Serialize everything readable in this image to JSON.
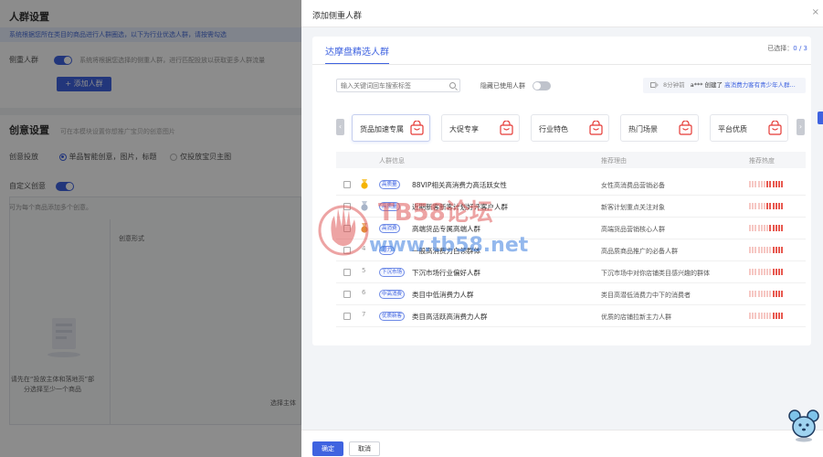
{
  "background": {
    "section1_title": "人群设置",
    "info_text": "系统根据您所在类目的商品进行人群圈选，以下为行业优选人群，请按需勾选",
    "row1_label": "侧重人群",
    "row1_desc": "系统将根据您选择的侧重人群，进行匹配投放以获取更多人群流量",
    "add_button": "+ 添加人群(0/3)",
    "section2_title": "创意设置",
    "section2_desc": "可在本模块设置你想推广宝贝的创意图片",
    "row2_label": "创意投放",
    "radio1": "单品智能创意，图片，标题",
    "radio2": "仅投放宝贝主图",
    "row3_label": "自定义创意",
    "panel_head": "可为每个商品添加多个创意。",
    "panel_col": "创意形式",
    "note": "请先在“投放主体和落地页”部分选择至少一个商品",
    "right_label": "选择主体"
  },
  "drawer": {
    "title": "添加侧重人群",
    "close": "×",
    "tab": "达摩盘精选人群",
    "selected_label": "已选择：",
    "selected_value": "0 / 3",
    "search_placeholder": "输入关键词回车搜索标签",
    "hide_used": "隐藏已使用人群",
    "notice_time": "8分钟前",
    "notice_user": "a*** 创建了",
    "notice_crowd": "高消费力客有青少年人群...",
    "categories": [
      "货品加速专属",
      "大促专享",
      "行业特色",
      "热门场景",
      "平台优质"
    ],
    "prev_arrow": "‹",
    "next_arrow": "›",
    "table": {
      "headers": [
        "人群信息",
        "推荐理由",
        "推荐热度"
      ],
      "rows": [
        {
          "rank": "1",
          "tag": "高质量",
          "name": "88VIP相关高消费力高活跃女性",
          "reason": "女性高消费品营销必备",
          "heat": 9
        },
        {
          "rank": "2",
          "tag": "高质量",
          "name": "近期新客新客计划好评客户人群",
          "reason": "新客计划重点关注对象",
          "heat": 9
        },
        {
          "rank": "3",
          "tag": "高消费",
          "name": "高端货品专属高端人群",
          "reason": "高端货品营销核心人群",
          "heat": 8
        },
        {
          "rank": "4",
          "tag": "潜力",
          "name": "一般高消费力白领群体",
          "reason": "高品质商品推广的必备人群",
          "heat": 7
        },
        {
          "rank": "5",
          "tag": "下沉市场",
          "name": "下沉市场行业偏好人群",
          "reason": "下沉市场中对你店铺类目感兴趣的群体",
          "heat": 7
        },
        {
          "rank": "6",
          "tag": "中高消费",
          "name": "类目中低消费力人群",
          "reason": "类目高潜低消费力中下的消费者",
          "heat": 7
        },
        {
          "rank": "7",
          "tag": "优质新客",
          "name": "类目高活跃高消费力人群",
          "reason": "优质的店铺拉新主力人群",
          "heat": 7
        }
      ]
    },
    "ok_button": "确定",
    "cancel_button": "取消"
  },
  "watermark": {
    "main": "TB58论坛",
    "url": "www.tb58.net"
  },
  "colors": {
    "accent": "#3f63e0",
    "heat_on": "#e8584f",
    "heat_off": "#f6c8c4"
  }
}
